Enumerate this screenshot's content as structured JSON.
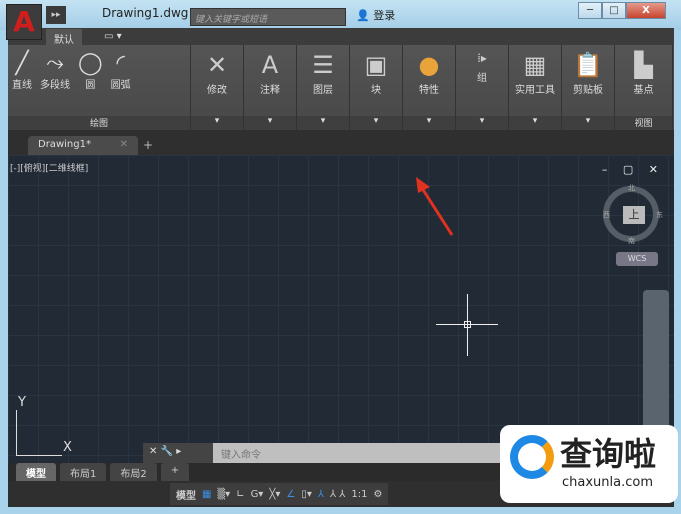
{
  "title_bar": {
    "app_icon": "A",
    "document_title": "Drawing1.dwg",
    "search_placeholder": "键入关键字或短语",
    "login": "登录",
    "window_buttons": [
      "─",
      "□",
      "X"
    ]
  },
  "ribbon_tabs": [
    "默认",
    "▭ ▾"
  ],
  "ribbon_panels": [
    {
      "name": "绘图",
      "items": [
        "直线",
        "多段线",
        "圆",
        "圆弧"
      ]
    },
    {
      "name": "修改"
    },
    {
      "name": "注释"
    },
    {
      "name": "图层"
    },
    {
      "name": "块"
    },
    {
      "name": "特性"
    },
    {
      "name": "组"
    },
    {
      "name": "实用工具"
    },
    {
      "name": "剪贴板"
    },
    {
      "name": "基点",
      "footer": "视图"
    }
  ],
  "doc_tabs": {
    "active": "Drawing1*",
    "add": "+"
  },
  "viewport": {
    "label": "[-][俯视][二维线框]",
    "controls": "– ▢ ✕",
    "viewcube": {
      "face": "上",
      "north": "北",
      "south": "南",
      "east": "东",
      "west": "西"
    },
    "wcs": "WCS",
    "ucs_x": "X",
    "ucs_y": "Y"
  },
  "command_line": {
    "placeholder": "键入命令",
    "icons": "✕ 🔧 ▸"
  },
  "layout_tabs": [
    "模型",
    "布局1",
    "布局2",
    "+"
  ],
  "status_bar": {
    "model": "模型",
    "scale": "1:1"
  },
  "watermark": {
    "name": "查询啦",
    "url": "chaxunla.com"
  }
}
